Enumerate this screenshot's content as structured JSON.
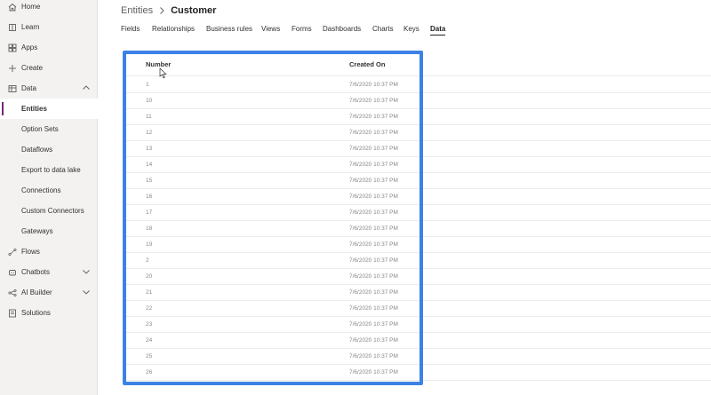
{
  "sidebar": {
    "items": [
      {
        "label": "Home",
        "icon": "home-icon"
      },
      {
        "label": "Learn",
        "icon": "book-icon"
      },
      {
        "label": "Apps",
        "icon": "apps-icon"
      },
      {
        "label": "Create",
        "icon": "plus-icon"
      },
      {
        "label": "Data",
        "icon": "table-icon"
      },
      {
        "label": "Entities"
      },
      {
        "label": "Option Sets"
      },
      {
        "label": "Dataflows"
      },
      {
        "label": "Export to data lake"
      },
      {
        "label": "Connections"
      },
      {
        "label": "Custom Connectors"
      },
      {
        "label": "Gateways"
      },
      {
        "label": "Flows",
        "icon": "flow-icon"
      },
      {
        "label": "Chatbots",
        "icon": "chatbot-icon"
      },
      {
        "label": "AI Builder",
        "icon": "ai-builder-icon"
      },
      {
        "label": "Solutions",
        "icon": "solutions-icon"
      }
    ],
    "active_item": "Entities"
  },
  "breadcrumb": {
    "parent": "Entities",
    "current": "Customer"
  },
  "tabs": [
    "Fields",
    "Relationships",
    "Business rules",
    "Views",
    "Forms",
    "Dashboards",
    "Charts",
    "Keys",
    "Data"
  ],
  "active_tab": "Data",
  "table": {
    "columns": [
      "Number",
      "Created On"
    ],
    "rows": [
      [
        "1",
        "7/6/2020 10:37 PM"
      ],
      [
        "10",
        "7/6/2020 10:37 PM"
      ],
      [
        "11",
        "7/6/2020 10:37 PM"
      ],
      [
        "12",
        "7/6/2020 10:37 PM"
      ],
      [
        "13",
        "7/6/2020 10:37 PM"
      ],
      [
        "14",
        "7/6/2020 10:37 PM"
      ],
      [
        "15",
        "7/6/2020 10:37 PM"
      ],
      [
        "16",
        "7/6/2020 10:37 PM"
      ],
      [
        "17",
        "7/6/2020 10:37 PM"
      ],
      [
        "18",
        "7/6/2020 10:37 PM"
      ],
      [
        "19",
        "7/6/2020 10:37 PM"
      ],
      [
        "2",
        "7/6/2020 10:37 PM"
      ],
      [
        "20",
        "7/6/2020 10:37 PM"
      ],
      [
        "21",
        "7/6/2020 10:37 PM"
      ],
      [
        "22",
        "7/6/2020 10:37 PM"
      ],
      [
        "23",
        "7/6/2020 10:37 PM"
      ],
      [
        "24",
        "7/6/2020 10:37 PM"
      ],
      [
        "25",
        "7/6/2020 10:37 PM"
      ],
      [
        "26",
        "7/6/2020 10:37 PM"
      ]
    ]
  },
  "colors": {
    "accent": "#742774",
    "highlight": "#3c82e6"
  }
}
